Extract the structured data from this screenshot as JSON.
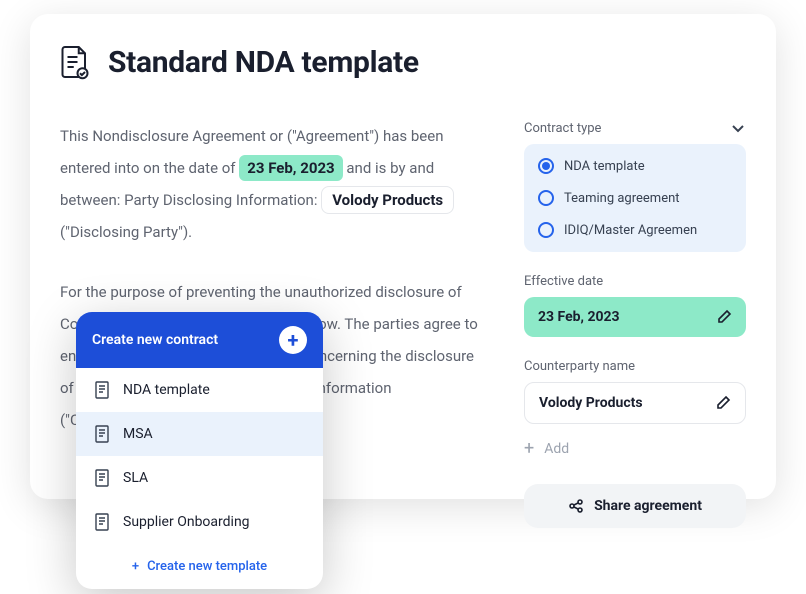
{
  "header": {
    "title": "Standard NDA template"
  },
  "body": {
    "p1_a": "This Nondisclosure Agreement or (\"Agreement\") has been entered into on the date of ",
    "date": "23 Feb, 2023",
    "p1_b": " and is by and between: Party Disclosing Information: ",
    "party": "Volody Products",
    "p1_c": " (\"Disclosing Party\").",
    "p2": "For the purpose of preventing the unauthorized disclosure of Confidential Information as defined below. The parties agree to enter into a confidential relationship concerning the disclosure of certain proprietary and confidential information (\"Confidential Information\")."
  },
  "sidebar": {
    "contract_type_label": "Contract type",
    "options": [
      {
        "label": "NDA template",
        "selected": true
      },
      {
        "label": "Teaming agreement",
        "selected": false
      },
      {
        "label": "IDIQ/Master Agreemen",
        "selected": false
      }
    ],
    "effective_date_label": "Effective date",
    "effective_date": "23 Feb, 2023",
    "counterparty_label": "Counterparty name",
    "counterparty": "Volody Products",
    "add_label": "Add",
    "share_label": "Share agreement"
  },
  "dropdown": {
    "header": "Create new contract",
    "items": [
      "NDA template",
      "MSA",
      "SLA",
      "Supplier Onboarding"
    ],
    "hover_index": 1,
    "create_label": "Create new template"
  }
}
